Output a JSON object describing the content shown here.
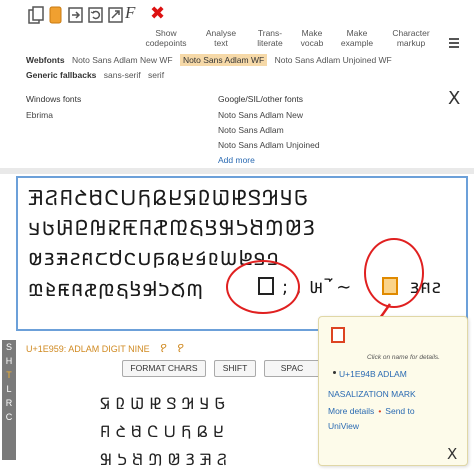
{
  "toolbar": {
    "icons": [
      "copy-icon",
      "orange-box-icon",
      "swap-icon",
      "refresh-icon",
      "font-italic-icon",
      "clear-icon"
    ],
    "clear_glyph": "✖",
    "italic_glyph": "F",
    "menus": [
      {
        "line1": "Show",
        "line2": "codepoints"
      },
      {
        "line1": "Analyse",
        "line2": "text"
      },
      {
        "line1": "Trans-",
        "line2": "literate"
      },
      {
        "line1": "Make",
        "line2": "vocab"
      },
      {
        "line1": "Make",
        "line2": "example"
      },
      {
        "line1": "Character",
        "line2": "markup"
      }
    ]
  },
  "webfonts": {
    "label": "Webfonts",
    "options": [
      "Noto Sans Adlam New WF",
      "Noto Sans Adlam WF",
      "Noto Sans Adlam Unjoined WF"
    ],
    "selected_index": 1
  },
  "generic": {
    "label": "Generic fallbacks",
    "options": [
      "sans-serif",
      "serif"
    ]
  },
  "fonts_panel": {
    "windows_heading": "Windows fonts",
    "windows_fonts": [
      "Ebrima"
    ],
    "google_heading": "Google/SIL/other fonts",
    "google_fonts": [
      "Noto Sans Adlam New",
      "Noto Sans Adlam",
      "Noto Sans Adlam Unjoined"
    ],
    "add_more": "Add more",
    "close_glyph": "X"
  },
  "text_lines": [
    "𞤀𞤁𞤂𞤃𞤄𞤅𞤆𞤇𞤈𞤉𞤊𞤋𞤌𞤍𞤎𞤏𞤐𞤑",
    "𞤒𞤓𞤔𞤕𞤖𞤗𞤘𞤙𞤚𞤛𞤜𞤝𞤞𞤟𞤠𞤡𞤢𞤣",
    "𞤤𞤥𞤦𞤧𞤨𞤩𞤪𞤫𞤬𞤭𞤮𞤯𞤰𞤱𞤲𞤳𞤴𞤵",
    "𞤶𞤷𞤸𞤹𞤺𞤻𞤼𞤽𞤾𞤿𞥀𞥁"
  ],
  "line4_tail": "; , 𞥃 𞥄 ∼",
  "line4_end": "𞤲𞤱𞤴",
  "side_tabs": [
    "S",
    "H",
    "T",
    "L",
    "R",
    "C"
  ],
  "side_tabs_active": 2,
  "char_info": {
    "label": "U+1E959: ADLAM DIGIT NINE",
    "glyph1": "𞥙",
    "glyph2": "𞥙"
  },
  "buttons": {
    "format_chars": "FORMAT CHARS",
    "shift": "SHIFT",
    "space": "SPAC"
  },
  "keyboard_rows": [
    "𞤀 𞤁 𞤂 𞤃 𞤄 𞤅 𞤆 𞤇",
    "𞤈 𞤉 𞤊 𞤋 𞤌 𞤍 𞤎 𞤏",
    "𞤐 𞤑 𞤒 𞤓 𞤔 𞤕 𞤖 𞤗"
  ],
  "popup": {
    "hint": "Click on name for details.",
    "code": "U+1E94B ADLAM",
    "name": "NASALIZATION MARK",
    "more_details": "More details",
    "sep": "•",
    "send_to": "Send to",
    "uniview": "UniView",
    "close_glyph": "X"
  },
  "colors": {
    "accent_blue": "#6ca0d9",
    "highlight_orange": "#f6d9a8",
    "circle_red": "#e02020",
    "link_blue": "#2a6ab2",
    "info_orange": "#d08a22"
  }
}
